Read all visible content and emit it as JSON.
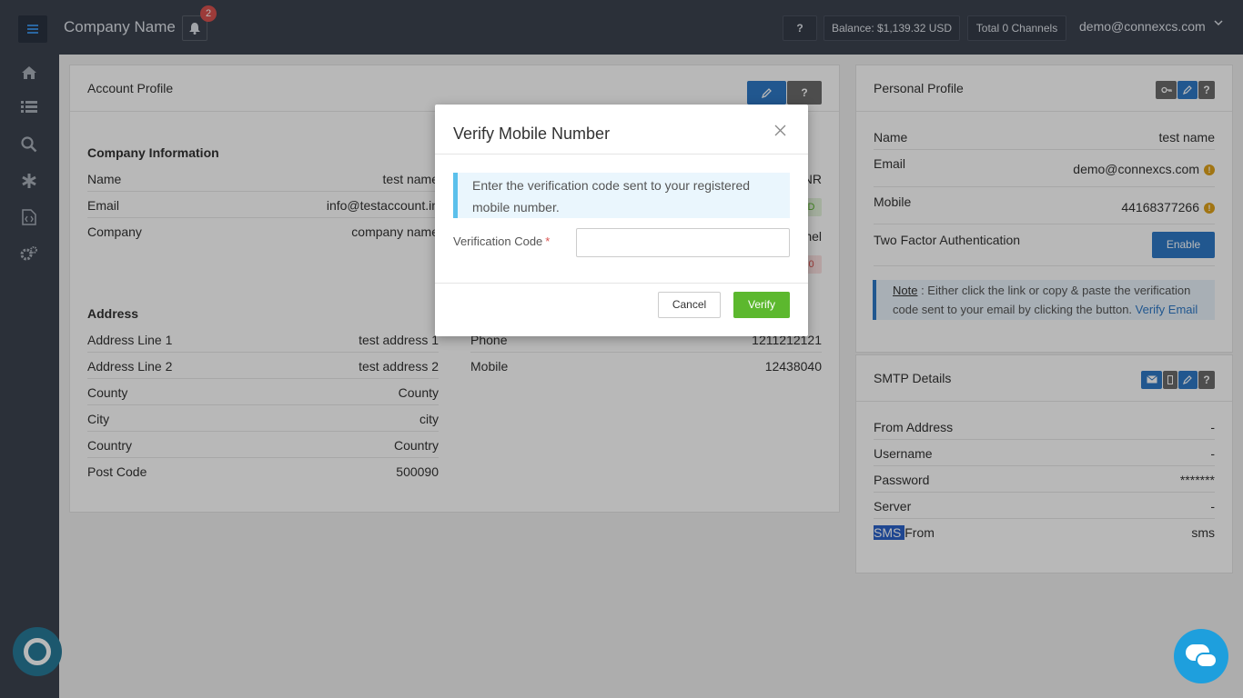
{
  "topbar": {
    "company_name": "Company Name",
    "notification_count": "2",
    "help_label": "?",
    "balance": "Balance: $1,139.32 USD",
    "channels": "Total 0 Channels",
    "user_email": "demo@connexcs.com"
  },
  "sidebar": {
    "icons": [
      "home-icon",
      "list-icon",
      "search-icon",
      "asterisk-icon",
      "code-file-icon",
      "gears-icon"
    ]
  },
  "account_profile": {
    "title": "Account Profile",
    "edit_icon": "pencil-icon",
    "help_label": "?",
    "company_info_heading": "Company Information",
    "company_rows": [
      {
        "label": "Name",
        "value": "test name"
      },
      {
        "label": "Email",
        "value": "info@testaccount.in"
      },
      {
        "label": "Company",
        "value": "company name"
      }
    ],
    "right_fragments": [
      "NR",
      "D",
      "nel",
      "0"
    ],
    "address_heading": "Address",
    "address_rows": [
      {
        "label": "Address Line 1",
        "value": "test address 1"
      },
      {
        "label": "Address Line 2",
        "value": "test address 2"
      },
      {
        "label": "County",
        "value": "County"
      },
      {
        "label": "City",
        "value": "city"
      },
      {
        "label": "Country",
        "value": "Country"
      },
      {
        "label": "Post Code",
        "value": "500090"
      }
    ],
    "contact_rows": [
      {
        "label": "Phone",
        "value": "1211212121"
      },
      {
        "label": "Mobile",
        "value": "12438040"
      }
    ]
  },
  "personal_profile": {
    "title": "Personal Profile",
    "help_label": "?",
    "rows": [
      {
        "label": "Name",
        "value": "test name"
      },
      {
        "label": "Email",
        "value": "demo@connexcs.com"
      },
      {
        "label": "Mobile",
        "value": "44168377266"
      },
      {
        "label": "Two Factor Authentication",
        "value": ""
      }
    ],
    "enable_label": "Enable",
    "note_label": "Note",
    "note_text": " : Either click the link or copy & paste the verification code sent to your email by clicking the button. ",
    "note_link": "Verify Email"
  },
  "smtp": {
    "title": "SMTP Details",
    "help_label": "?",
    "rows": [
      {
        "label": "From Address",
        "value": "-"
      },
      {
        "label": "Username",
        "value": "-"
      },
      {
        "label": "Password",
        "value": "*******"
      },
      {
        "label": "Server",
        "value": "-"
      }
    ],
    "sms_label_highlight": "SMS ",
    "sms_label_rest": "From",
    "sms_value": "sms"
  },
  "modal": {
    "title": "Verify Mobile Number",
    "close_symbol": "×",
    "alert_text": "Enter the verification code sent to your registered mobile number.",
    "field_label": "Verification Code",
    "required_mark": "*",
    "field_value": "",
    "field_placeholder": "",
    "cancel_label": "Cancel",
    "verify_label": "Verify"
  },
  "colors": {
    "topbar": "#3c4350",
    "primary": "#2f79c6",
    "success": "#5cb82e",
    "info_border": "#5bc0eb",
    "warning": "#e0a21b"
  }
}
